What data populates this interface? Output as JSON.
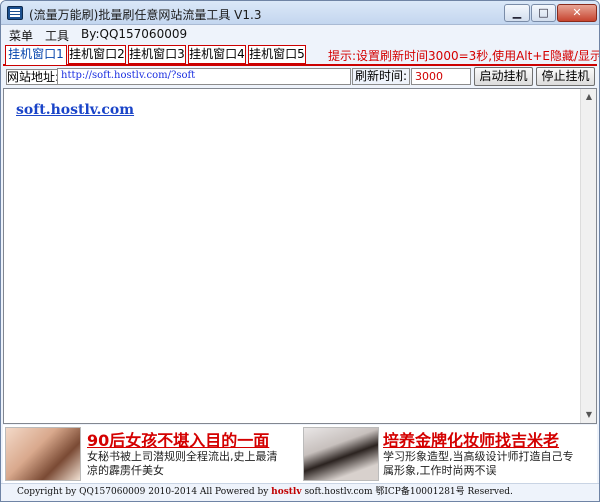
{
  "window": {
    "title": "(流量万能刷)批量刷任意网站流量工具 V1.3",
    "min_label": "▁",
    "max_label": "□",
    "close_label": "✕"
  },
  "menu": {
    "items": [
      "菜单",
      "工具",
      "By:QQ157060009"
    ]
  },
  "tabs": {
    "items": [
      "挂机窗口1",
      "挂机窗口2",
      "挂机窗口3",
      "挂机窗口4",
      "挂机窗口5"
    ],
    "active_index": 0,
    "hint": "提示:设置刷新时间3000=3秒,使用Alt+E隐藏/显示界面"
  },
  "toolbar": {
    "address_label": "网站地址:",
    "address_value": "http://soft.hostlv.com/?soft",
    "refresh_label": "刷新时间:",
    "refresh_value": "3000",
    "start_button": "启动挂机",
    "stop_button": "停止挂机"
  },
  "browser": {
    "link_text": "soft.hostlv.com"
  },
  "ads": [
    {
      "title": "90后女孩不堪入目的一面",
      "desc": "女秘书被上司潜规则全程流出,史上最清凉的霹雳仟美女"
    },
    {
      "title": "培养金牌化妆师找吉米老",
      "desc": "学习形象造型,当高级设计师打造自己专属形象,工作时尚两不误"
    }
  ],
  "status": {
    "prefix": "Copyright by QQ157060009 2010-2014 All Powered by ",
    "highlight": "hostlv",
    "suffix": " soft.hostlv.com 鄂ICP备10001281号 Reserved."
  },
  "colors": {
    "accent_red": "#d40000",
    "link_blue": "#1a44c8",
    "title_bg": "#c3d6ef"
  }
}
